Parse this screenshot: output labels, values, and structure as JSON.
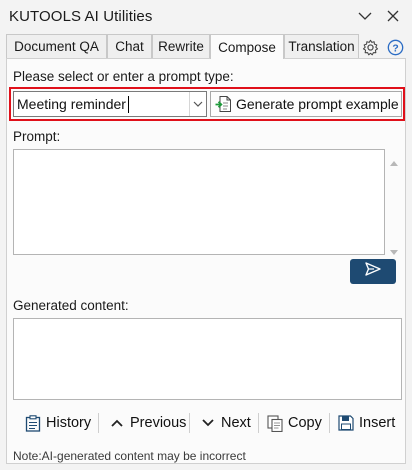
{
  "window": {
    "title": "KUTOOLS AI Utilities",
    "icons": [
      "chevron-down-icon",
      "close-icon"
    ]
  },
  "tabs": [
    {
      "label": "Document QA",
      "active": false
    },
    {
      "label": "Chat",
      "active": false
    },
    {
      "label": "Rewrite",
      "active": false
    },
    {
      "label": "Compose",
      "active": true
    },
    {
      "label": "Translation",
      "active": false
    }
  ],
  "tab_icons": [
    "gear-icon",
    "help-icon"
  ],
  "prompt_type": {
    "label": "Please select or enter a prompt type:",
    "value": "Meeting reminder",
    "generate_button_label": "Generate prompt example"
  },
  "prompt": {
    "label": "Prompt:",
    "value": "",
    "send_icon": "send-icon"
  },
  "generated": {
    "label": "Generated content:",
    "value": ""
  },
  "toolbar": {
    "history_label": "History",
    "previous_label": "Previous",
    "next_label": "Next",
    "copy_label": "Copy",
    "insert_label": "Insert"
  },
  "note": "Note:AI-generated content may be incorrect",
  "colors": {
    "accent": "#1e4a72",
    "highlight": "#e0101a",
    "help": "#2b6cc4"
  }
}
